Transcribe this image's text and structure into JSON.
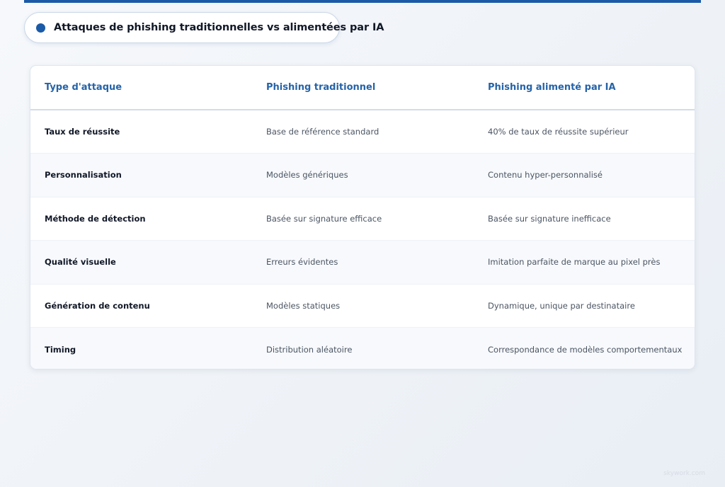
{
  "page": {
    "title": "Attaques de phishing traditionnelles vs alimentées par IA",
    "watermark": "skywork.com",
    "accent_color": "#1b5aa6"
  },
  "table": {
    "headers": [
      "Type d'attaque",
      "Phishing traditionnel",
      "Phishing alimenté par IA"
    ],
    "rows": [
      [
        "Taux de réussite",
        "Base de référence standard",
        "40% de taux de réussite supérieur"
      ],
      [
        "Personnalisation",
        "Modèles génériques",
        "Contenu hyper-personnalisé"
      ],
      [
        "Méthode de détection",
        "Basée sur signature efficace",
        "Basée sur signature inefficace"
      ],
      [
        "Qualité visuelle",
        "Erreurs évidentes",
        "Imitation parfaite de marque au pixel près"
      ],
      [
        "Génération de contenu",
        "Modèles statiques",
        "Dynamique, unique par destinataire"
      ],
      [
        "Timing",
        "Distribution aléatoire",
        "Correspondance de modèles comportementaux"
      ]
    ]
  }
}
